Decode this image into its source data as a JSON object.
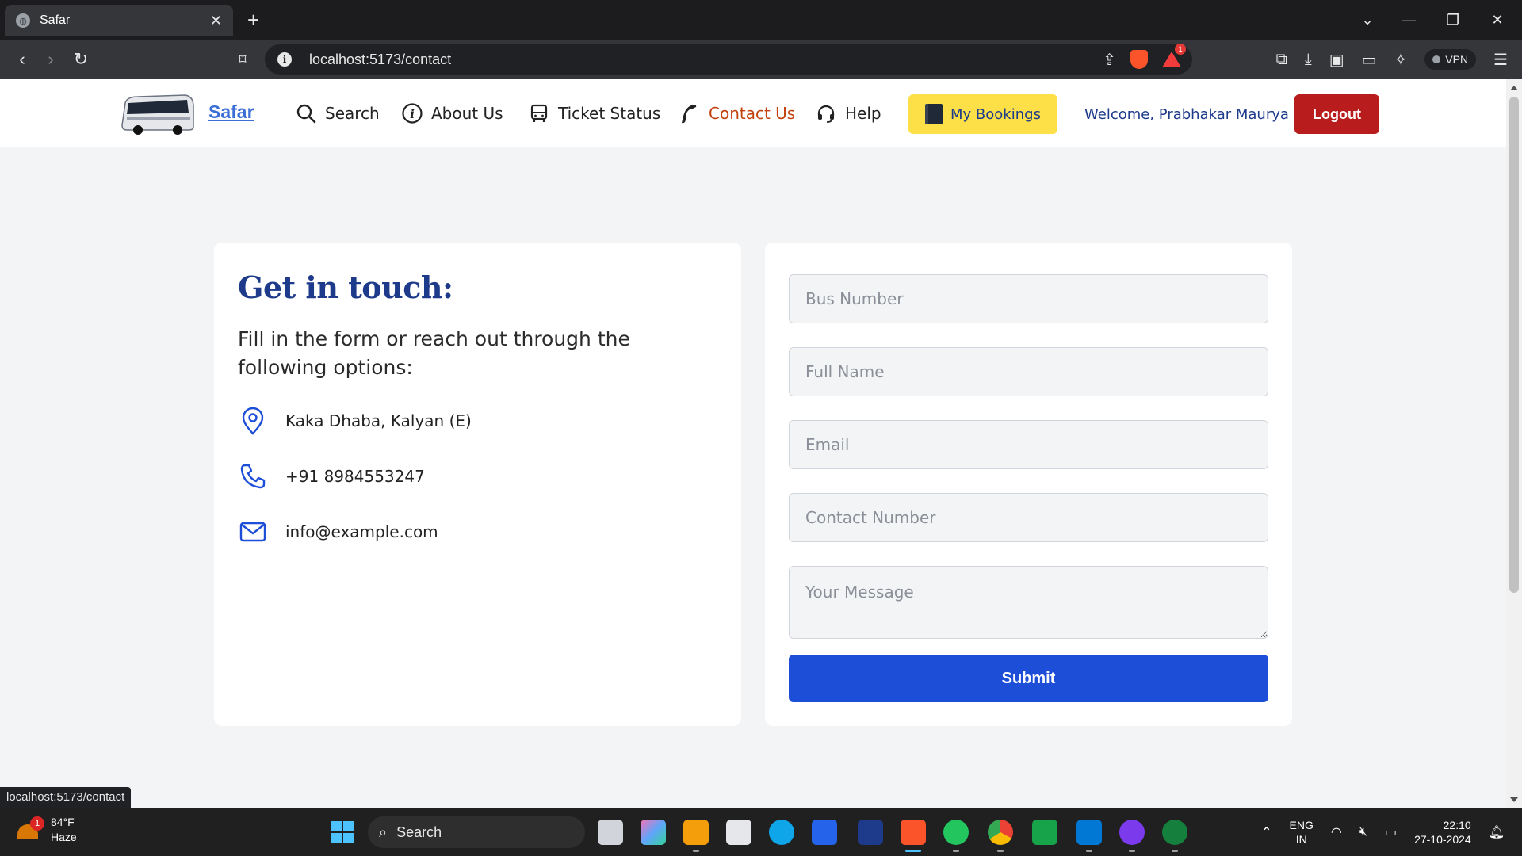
{
  "browser": {
    "tab_title": "Safar",
    "url": "localhost:5173/contact",
    "vpn_label": "VPN",
    "notification_count": "1",
    "status_url": "localhost:5173/contact"
  },
  "header": {
    "brand": "Safar",
    "nav": [
      {
        "label": "Search",
        "icon": "search-icon"
      },
      {
        "label": "About Us",
        "icon": "info-icon"
      },
      {
        "label": "Ticket Status",
        "icon": "bus-icon"
      },
      {
        "label": "Contact Us",
        "icon": "phone-icon"
      },
      {
        "label": "Help",
        "icon": "headset-icon"
      }
    ],
    "bookings_label": "My Bookings",
    "welcome": "Welcome, Prabhakar Maurya",
    "logout_label": "Logout",
    "active_color": "#c2410c"
  },
  "contact_info": {
    "title": "Get in touch:",
    "subtitle": "Fill in the form or reach out through the following options:",
    "address": "Kaka Dhaba, Kalyan (E)",
    "phone": "+91 8984553247",
    "email": "info@example.com"
  },
  "form": {
    "bus_number_placeholder": "Bus Number",
    "full_name_placeholder": "Full Name",
    "email_placeholder": "Email",
    "contact_number_placeholder": "Contact Number",
    "message_placeholder": "Your Message",
    "submit_label": "Submit"
  },
  "taskbar": {
    "weather_temp": "84°F",
    "weather_desc": "Haze",
    "weather_badge": "1",
    "search_label": "Search",
    "lang_line1": "ENG",
    "lang_line2": "IN",
    "time": "22:10",
    "date": "27-10-2024"
  },
  "colors": {
    "brand_blue": "#1e3a8a",
    "submit_blue": "#1d4ed8",
    "logout_red": "#b91c1c",
    "bookings_yellow": "#fde047"
  }
}
